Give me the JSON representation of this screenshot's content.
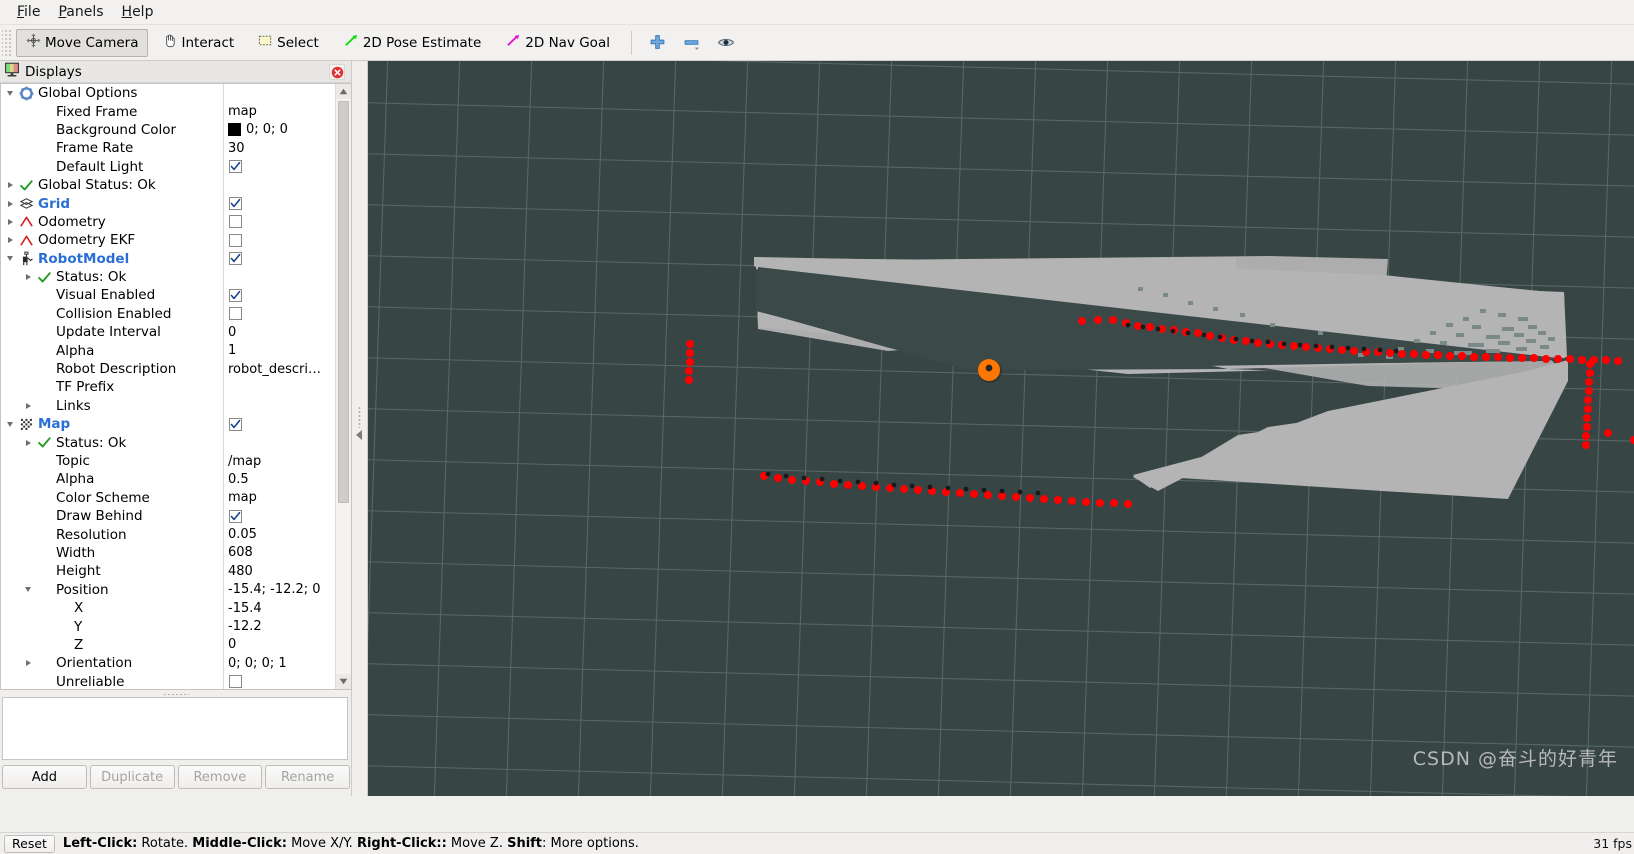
{
  "menu": {
    "items": [
      {
        "label": "File",
        "accel": "F"
      },
      {
        "label": "Panels",
        "accel": "P"
      },
      {
        "label": "Help",
        "accel": "H"
      }
    ]
  },
  "toolbar": {
    "buttons": [
      {
        "label": "Move Camera",
        "icon": "move-camera-icon",
        "active": true
      },
      {
        "label": "Interact",
        "icon": "hand-cursor-icon",
        "active": false
      },
      {
        "label": "Select",
        "icon": "selection-box-icon",
        "active": false
      },
      {
        "label": "2D Pose Estimate",
        "icon": "green-arrow-icon",
        "active": false
      },
      {
        "label": "2D Nav Goal",
        "icon": "magenta-arrow-icon",
        "active": false
      }
    ],
    "icon_buttons": [
      {
        "name": "add-tool-icon",
        "glyph": "plus"
      },
      {
        "name": "remove-tool-icon",
        "glyph": "minus"
      },
      {
        "name": "visibility-eye-icon",
        "glyph": "eye"
      }
    ]
  },
  "displays": {
    "title": "Displays",
    "close_label": "x",
    "tree": [
      {
        "indent": 0,
        "twist": "down",
        "icon": "gear-icon",
        "label": "Global Options",
        "style": "plain",
        "value": ""
      },
      {
        "indent": 1,
        "twist": "none",
        "icon": "none",
        "label": "Fixed Frame",
        "style": "plain",
        "value": "map"
      },
      {
        "indent": 1,
        "twist": "none",
        "icon": "none",
        "label": "Background Color",
        "style": "plain",
        "value": "0; 0; 0",
        "swatch": "#000000"
      },
      {
        "indent": 1,
        "twist": "none",
        "icon": "none",
        "label": "Frame Rate",
        "style": "plain",
        "value": "30"
      },
      {
        "indent": 1,
        "twist": "none",
        "icon": "none",
        "label": "Default Light",
        "style": "plain",
        "check": "on"
      },
      {
        "indent": 0,
        "twist": "right",
        "icon": "check-green-icon",
        "label": "Global Status: Ok",
        "style": "plain",
        "value": ""
      },
      {
        "indent": 0,
        "twist": "right",
        "icon": "grid-icon",
        "label": "Grid",
        "style": "bold-blue",
        "check": "on"
      },
      {
        "indent": 0,
        "twist": "right",
        "icon": "odometry-icon",
        "label": "Odometry",
        "style": "plain",
        "check": "off"
      },
      {
        "indent": 0,
        "twist": "right",
        "icon": "odometry-icon",
        "label": "Odometry EKF",
        "style": "plain",
        "check": "off"
      },
      {
        "indent": 0,
        "twist": "down",
        "icon": "robot-model-icon",
        "label": "RobotModel",
        "style": "bold-blue",
        "check": "on"
      },
      {
        "indent": 1,
        "twist": "right",
        "icon": "check-green-icon",
        "label": "Status: Ok",
        "style": "plain",
        "value": ""
      },
      {
        "indent": 1,
        "twist": "none",
        "icon": "none",
        "label": "Visual Enabled",
        "style": "plain",
        "check": "on"
      },
      {
        "indent": 1,
        "twist": "none",
        "icon": "none",
        "label": "Collision Enabled",
        "style": "plain",
        "check": "off"
      },
      {
        "indent": 1,
        "twist": "none",
        "icon": "none",
        "label": "Update Interval",
        "style": "plain",
        "value": "0"
      },
      {
        "indent": 1,
        "twist": "none",
        "icon": "none",
        "label": "Alpha",
        "style": "plain",
        "value": "1"
      },
      {
        "indent": 1,
        "twist": "none",
        "icon": "none",
        "label": "Robot Description",
        "style": "plain",
        "value": "robot_descri…"
      },
      {
        "indent": 1,
        "twist": "none",
        "icon": "none",
        "label": "TF Prefix",
        "style": "plain",
        "value": ""
      },
      {
        "indent": 1,
        "twist": "right",
        "icon": "none",
        "label": "Links",
        "style": "plain",
        "value": ""
      },
      {
        "indent": 0,
        "twist": "down",
        "icon": "map-icon",
        "label": "Map",
        "style": "bold-blue",
        "check": "on"
      },
      {
        "indent": 1,
        "twist": "right",
        "icon": "check-green-icon",
        "label": "Status: Ok",
        "style": "plain",
        "value": ""
      },
      {
        "indent": 1,
        "twist": "none",
        "icon": "none",
        "label": "Topic",
        "style": "plain",
        "value": "/map"
      },
      {
        "indent": 1,
        "twist": "none",
        "icon": "none",
        "label": "Alpha",
        "style": "plain",
        "value": "0.5"
      },
      {
        "indent": 1,
        "twist": "none",
        "icon": "none",
        "label": "Color Scheme",
        "style": "plain",
        "value": "map"
      },
      {
        "indent": 1,
        "twist": "none",
        "icon": "none",
        "label": "Draw Behind",
        "style": "plain",
        "check": "on"
      },
      {
        "indent": 1,
        "twist": "none",
        "icon": "none",
        "label": "Resolution",
        "style": "plain",
        "value": "0.05"
      },
      {
        "indent": 1,
        "twist": "none",
        "icon": "none",
        "label": "Width",
        "style": "plain",
        "value": "608"
      },
      {
        "indent": 1,
        "twist": "none",
        "icon": "none",
        "label": "Height",
        "style": "plain",
        "value": "480"
      },
      {
        "indent": 1,
        "twist": "down",
        "icon": "none",
        "label": "Position",
        "style": "plain",
        "value": "-15.4; -12.2; 0"
      },
      {
        "indent": 2,
        "twist": "none",
        "icon": "none",
        "label": "X",
        "style": "plain",
        "value": "-15.4"
      },
      {
        "indent": 2,
        "twist": "none",
        "icon": "none",
        "label": "Y",
        "style": "plain",
        "value": "-12.2"
      },
      {
        "indent": 2,
        "twist": "none",
        "icon": "none",
        "label": "Z",
        "style": "plain",
        "value": "0"
      },
      {
        "indent": 1,
        "twist": "right",
        "icon": "none",
        "label": "Orientation",
        "style": "plain",
        "value": "0; 0; 0; 1"
      },
      {
        "indent": 1,
        "twist": "none",
        "icon": "none",
        "label": "Unreliable",
        "style": "plain",
        "check": "off"
      }
    ],
    "buttons": [
      {
        "label": "Add",
        "enabled": true
      },
      {
        "label": "Duplicate",
        "enabled": false
      },
      {
        "label": "Remove",
        "enabled": false
      },
      {
        "label": "Rename",
        "enabled": false
      }
    ]
  },
  "viewport": {
    "background_color": "#374544",
    "grid_color": "#5f6f6e",
    "map_free_color": "#b4b4b4",
    "map_shadow_color": "#8c8c8c",
    "scan_color": "#ff0000",
    "robot_color": "#ff7700",
    "robot_center_color": "#262626"
  },
  "statusbar": {
    "reset_label": "Reset",
    "hint_parts": [
      {
        "text": "Left-Click:",
        "bold": true
      },
      {
        "text": " Rotate. ",
        "bold": false
      },
      {
        "text": "Middle-Click:",
        "bold": true
      },
      {
        "text": " Move X/Y. ",
        "bold": false
      },
      {
        "text": "Right-Click::",
        "bold": true
      },
      {
        "text": " Move Z. ",
        "bold": false
      },
      {
        "text": "Shift",
        "bold": true
      },
      {
        "text": ": More options.",
        "bold": false
      }
    ],
    "fps": "31 fps"
  },
  "watermark": {
    "text": "CSDN @奋斗的好青年"
  }
}
